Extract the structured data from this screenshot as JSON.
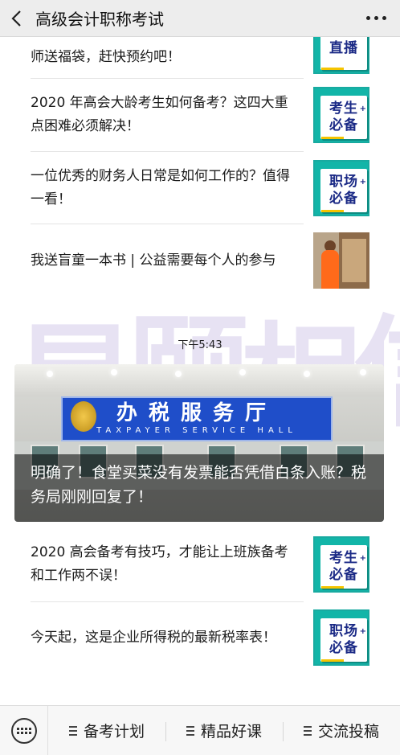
{
  "header": {
    "back_icon": "chevron-left-icon",
    "title": "高级会计职称考试",
    "more_icon": "more-dots-icon"
  },
  "articles_top": [
    {
      "title": "师送福袋，赶快预约吧！",
      "thumb": {
        "line1": "直播",
        "line2": ""
      }
    },
    {
      "title": "2020 年高会大龄考生如何备考？这四大重点困难必须解决！",
      "thumb": {
        "line1": "考生",
        "line2": "必备"
      }
    },
    {
      "title": "一位优秀的财务人日常是如何工作的？值得一看！",
      "thumb": {
        "line1": "职场",
        "line2": "必备"
      }
    },
    {
      "title": "我送盲童一本书 | 公益需要每个人的参与",
      "thumb": "photo"
    }
  ],
  "timestamp": "下午5:43",
  "banner": {
    "sign_main": "办税服务厅",
    "sign_sub": "TAXPAYER SERVICE HALL",
    "title": "明确了！食堂买菜没有发票能否凭借白条入账？税务局刚刚回复了！"
  },
  "articles_bottom": [
    {
      "title": "2020 高会备考有技巧，才能让上班族备考和工作两不误！",
      "thumb": {
        "line1": "考生",
        "line2": "必备"
      }
    },
    {
      "title": "今天起，这是企业所得税的最新税率表！",
      "thumb": {
        "line1": "职场",
        "line2": "必备"
      }
    }
  ],
  "bottom_menu": {
    "keyboard_icon": "keyboard-icon",
    "items": [
      {
        "label": "备考计划",
        "icon": "menu-lines-icon"
      },
      {
        "label": "精品好课",
        "icon": "menu-lines-icon"
      },
      {
        "label": "交流投稿",
        "icon": "menu-lines-icon"
      }
    ]
  },
  "colors": {
    "header_bg": "#ededed",
    "thumb_teal": "#12b5a8",
    "thumb_text": "#1b2a86",
    "sign_blue": "#1f4ec9"
  }
}
